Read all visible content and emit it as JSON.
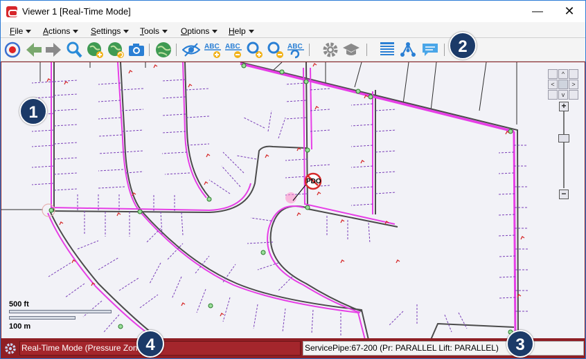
{
  "window": {
    "title": "Viewer 1 [Real-Time Mode]",
    "minimize_glyph": "—",
    "maximize_glyph": "☐",
    "close_glyph": "✕"
  },
  "menu": {
    "items": [
      {
        "label": "File",
        "accel": "F"
      },
      {
        "label": "Actions",
        "accel": "A"
      },
      {
        "label": "Settings",
        "accel": "S"
      },
      {
        "label": "Tools",
        "accel": "T"
      },
      {
        "label": "Options",
        "accel": "O"
      },
      {
        "label": "Help",
        "accel": "H"
      }
    ]
  },
  "toolbar": {
    "buttons": [
      "record-icon",
      "back-arrow-icon",
      "forward-arrow-icon",
      "zoom-search-icon",
      "globe-add-icon",
      "globe-refresh-icon",
      "camera-icon",
      "globe-icon",
      "eye-icon",
      "label-add-icon",
      "label-remove-icon",
      "zoom-in-icon",
      "zoom-out-icon",
      "label-refresh-icon",
      "gear-icon",
      "graduation-cap-icon",
      "table-icon",
      "network-icon",
      "comment-icon"
    ],
    "text_abc": "ABC"
  },
  "map": {
    "marker_label": "PDO",
    "scale": {
      "feet": "500 ft",
      "meters": "100 m"
    },
    "nav": {
      "up": "^",
      "down": "v",
      "left": "<",
      "right": ">",
      "zoom_in": "+",
      "zoom_out": "−"
    }
  },
  "callouts": [
    "1",
    "2",
    "3",
    "4"
  ],
  "status": {
    "mode": "Real-Time Mode (Pressure Zone)",
    "info": "ServicePipe:67-200 (Pr: PARALLEL Lift: PARALLEL)"
  },
  "colors": {
    "accent_pink": "#e63ee6",
    "service_purple": "#7a3fb8",
    "road": "#4b4b4b",
    "status_red": "#a4262c",
    "callout_navy": "#1b3a68"
  }
}
